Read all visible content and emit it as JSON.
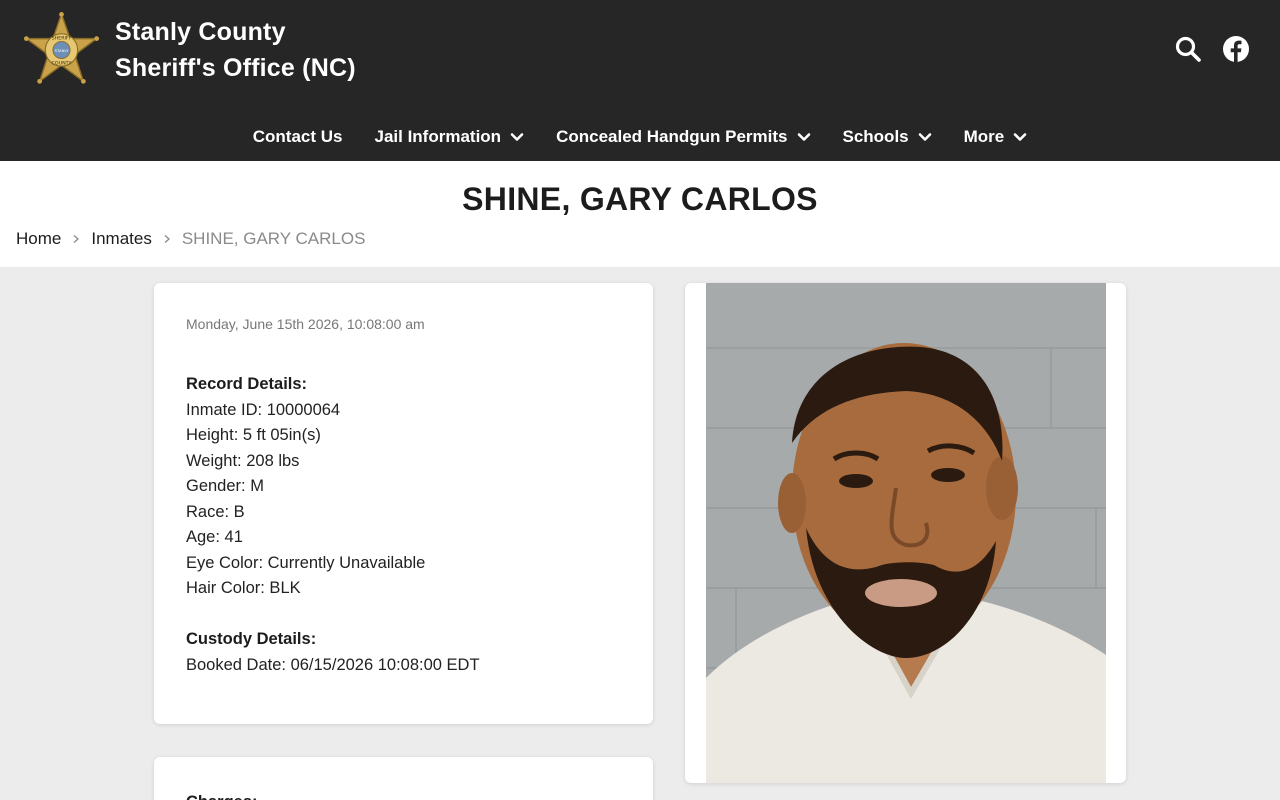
{
  "site": {
    "title_line1": "Stanly County",
    "title_line2": "Sheriff's Office (NC)",
    "badge_text_top": "SHERIFF",
    "badge_text_middle": "STANLY",
    "badge_text_bottom": "COUNTY"
  },
  "header_icons": [
    "search-icon",
    "facebook-icon"
  ],
  "nav": {
    "items": [
      {
        "label": "Contact Us",
        "dropdown": false
      },
      {
        "label": "Jail Information",
        "dropdown": true
      },
      {
        "label": "Concealed Handgun Permits",
        "dropdown": true
      },
      {
        "label": "Schools",
        "dropdown": true
      },
      {
        "label": "More",
        "dropdown": true
      }
    ]
  },
  "page": {
    "title": "SHINE, GARY CARLOS"
  },
  "breadcrumb": {
    "home": "Home",
    "inmates": "Inmates",
    "current": "SHINE, GARY CARLOS"
  },
  "record": {
    "timestamp": "Monday, June 15th 2026, 10:08:00 am",
    "record_label": "Record Details:",
    "inmate_id": "Inmate ID: 10000064",
    "height": "Height: 5 ft 05in(s)",
    "weight": "Weight: 208 lbs",
    "gender": "Gender: M",
    "race": "Race: B",
    "age": "Age: 41",
    "eye_color": "Eye Color: Currently Unavailable",
    "hair_color": "Hair Color: BLK",
    "custody_label": "Custody Details:",
    "booked_date": "Booked Date: 06/15/2026 10:08:00 EDT"
  },
  "charges": {
    "label": "Charges:"
  },
  "colors": {
    "header_bg": "#262626",
    "page_bg": "#ececec",
    "badge_gold": "#c9a24a"
  }
}
